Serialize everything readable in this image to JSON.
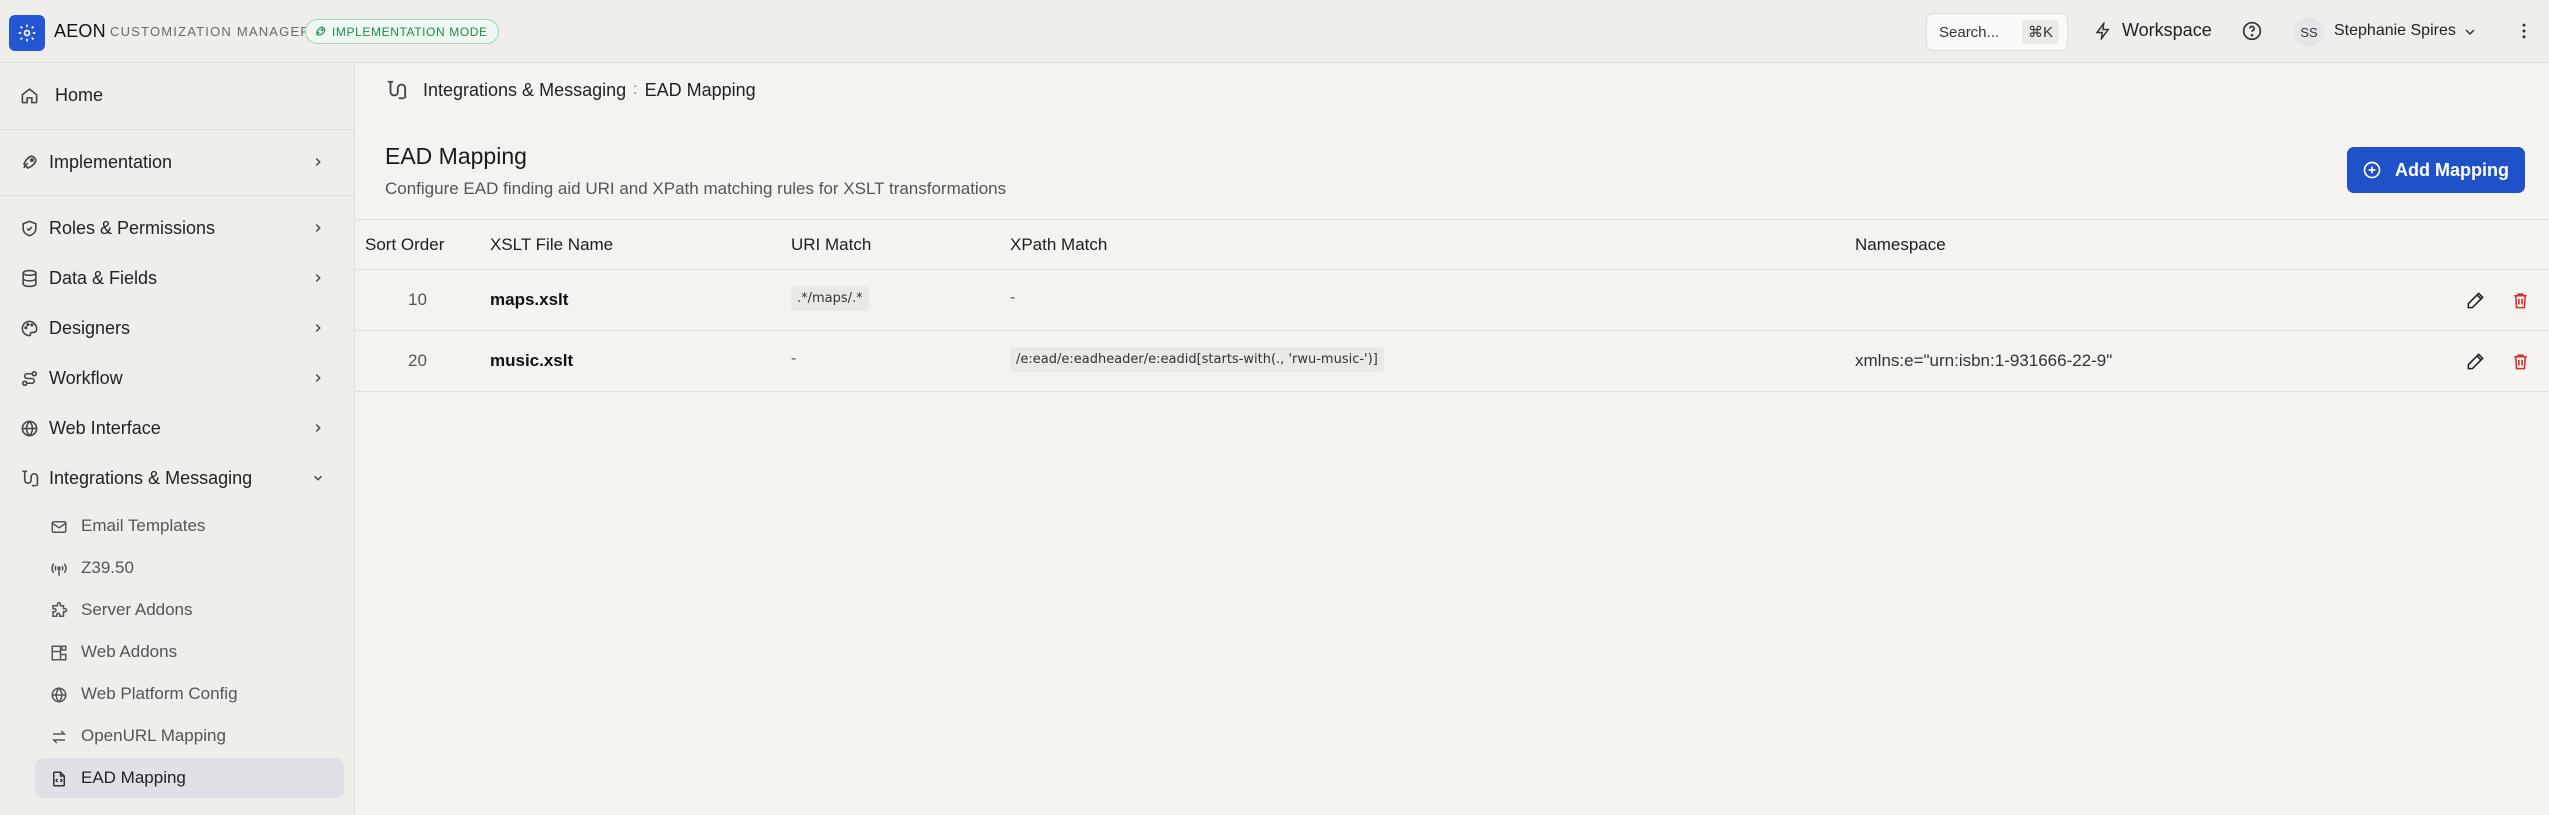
{
  "app": {
    "name": "AEON",
    "subtitle": "CUSTOMIZATION MANAGER",
    "mode_badge": "IMPLEMENTATION MODE"
  },
  "header": {
    "search_label": "Search...",
    "search_shortcut": "⌘K",
    "workspace_label": "Workspace",
    "user_initials": "SS",
    "user_name": "Stephanie Spires"
  },
  "sidebar": {
    "items": [
      {
        "label": "Home",
        "icon": "home-icon"
      },
      {
        "label": "Implementation",
        "icon": "rocket-icon"
      },
      {
        "label": "Roles & Permissions",
        "icon": "shield-icon"
      },
      {
        "label": "Data & Fields",
        "icon": "database-icon"
      },
      {
        "label": "Designers",
        "icon": "palette-icon"
      },
      {
        "label": "Workflow",
        "icon": "workflow-icon"
      },
      {
        "label": "Web Interface",
        "icon": "globe-icon"
      },
      {
        "label": "Integrations & Messaging",
        "icon": "integrations-icon",
        "expanded": true
      }
    ],
    "sub_items": [
      {
        "label": "Email Templates",
        "icon": "mail-icon"
      },
      {
        "label": "Z39.50",
        "icon": "antenna-icon"
      },
      {
        "label": "Server Addons",
        "icon": "puzzle-icon"
      },
      {
        "label": "Web Addons",
        "icon": "blocks-icon"
      },
      {
        "label": "Web Platform Config",
        "icon": "globe-icon"
      },
      {
        "label": "OpenURL Mapping",
        "icon": "arrows-icon"
      },
      {
        "label": "EAD Mapping",
        "icon": "file-code-icon",
        "active": true
      }
    ]
  },
  "breadcrumb": {
    "section": "Integrations & Messaging",
    "separator": ":",
    "page": "EAD Mapping"
  },
  "page": {
    "title": "EAD Mapping",
    "description": "Configure EAD finding aid URI and XPath matching rules for XSLT transformations",
    "add_button": "Add Mapping"
  },
  "table": {
    "columns": [
      "Sort Order",
      "XSLT File Name",
      "URI Match",
      "XPath Match",
      "Namespace"
    ],
    "rows": [
      {
        "sort_order": "10",
        "file": "maps.xslt",
        "uri_match": ".*/maps/.*",
        "xpath_match": "-",
        "namespace": ""
      },
      {
        "sort_order": "20",
        "file": "music.xslt",
        "uri_match": "-",
        "xpath_match": "/e:ead/e:eadheader/e:eadid[starts-with(., 'rwu-music-')]",
        "namespace": "xmlns:e=\"urn:isbn:1-931666-22-9\""
      }
    ]
  },
  "colors": {
    "primary": "#1f52c9",
    "logo": "#2456d3",
    "badge_green": "#1f8a47",
    "delete_red": "#d33131"
  }
}
